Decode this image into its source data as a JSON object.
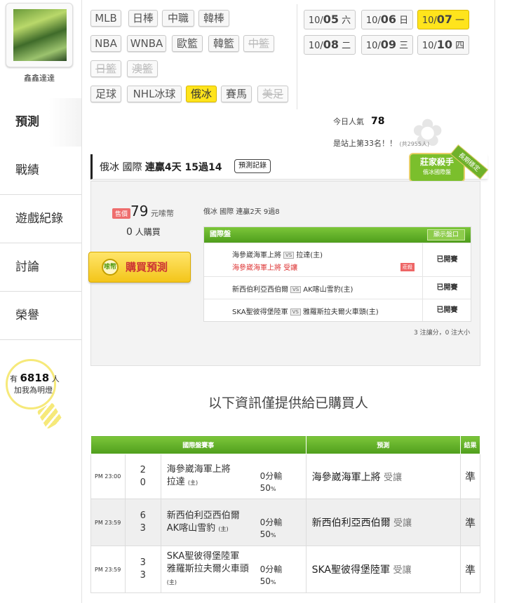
{
  "user": {
    "name": "鑫鑫達達"
  },
  "sidebar": {
    "items": [
      {
        "label": "預測"
      },
      {
        "label": "戰績"
      },
      {
        "label": "遊戲紀錄"
      },
      {
        "label": "討論"
      },
      {
        "label": "榮譽"
      }
    ]
  },
  "fans": {
    "prefix": "有",
    "count": "6818",
    "unit": "人",
    "caption": "加我為明燈"
  },
  "sports": [
    {
      "label": "MLB"
    },
    {
      "label": "日棒"
    },
    {
      "label": "中職"
    },
    {
      "label": "韓棒"
    },
    {
      "label": "NBA"
    },
    {
      "label": "WNBA"
    },
    {
      "label": "歐籃"
    },
    {
      "label": "韓籃"
    },
    {
      "label": "中籃"
    },
    {
      "label": "日籃"
    },
    {
      "label": "澳籃"
    },
    {
      "label": "足球"
    },
    {
      "label": "NHL冰球"
    },
    {
      "label": "俄冰"
    },
    {
      "label": "賽馬"
    },
    {
      "label": "美足"
    }
  ],
  "dates": [
    {
      "month": "10/",
      "day": "05",
      "weekday": "六"
    },
    {
      "month": "10/",
      "day": "06",
      "weekday": "日"
    },
    {
      "month": "10/",
      "day": "07",
      "weekday": "一"
    },
    {
      "month": "10/",
      "day": "08",
      "weekday": "二"
    },
    {
      "month": "10/",
      "day": "09",
      "weekday": "三"
    },
    {
      "month": "10/",
      "day": "10",
      "weekday": "四"
    }
  ],
  "popularity": {
    "label": "今日人氣",
    "value": "78",
    "rank_text": "是站上第33名！！",
    "rank_note": "(共2955人)"
  },
  "prediction_header": {
    "prefix": "俄冰 國際",
    "streak": "連贏4天 15過14",
    "record_button": "預測記錄"
  },
  "badge": {
    "title": "莊家殺手",
    "subtitle": "俄冰國際盤",
    "ribbon": "長期穩定"
  },
  "purchase": {
    "price_tag": "售價",
    "price": "79",
    "price_unit": "元嗦幣",
    "buyers_count": "0",
    "buyers_unit": "人購買",
    "buy_button": "購買預測",
    "coin_label": "嗦幣"
  },
  "sub_record": "俄冰 國際 連贏2天 9過8",
  "inner_table": {
    "title": "國際盤",
    "show_button": "顯示盤口",
    "rows": [
      {
        "home": "海參崴海軍上將",
        "away": "拉達(主)",
        "pick": "海參崴海軍上將 受讓",
        "pick_tag": "莊殺",
        "status": "已開賽"
      },
      {
        "home": "新西伯利亞西伯爾",
        "away": "AK喀山雪豹(主)",
        "status": "已開賽"
      },
      {
        "home": "SKA聖彼得堡陸軍",
        "away": "雅羅斯拉夫爾火車頭(主)",
        "status": "已開賽"
      }
    ],
    "vs": "VS",
    "note": "3 注讓分，0 注大小"
  },
  "info_title": "以下資訊僅提供給已購買人",
  "results": {
    "headers": [
      "國際盤賽事",
      "預測",
      "結果"
    ],
    "rows": [
      {
        "time": "PM 23:00",
        "score1": "2",
        "score2": "0",
        "team1": "海參崴海軍上將",
        "team2": "拉達",
        "team2_tag": "(主)",
        "handicap": "0分輸",
        "handicap_pct": "50",
        "handicap_pct_unit": "%",
        "pick": "海參崴海軍上將",
        "pick_type": "受讓",
        "result": "準"
      },
      {
        "time": "PM 23:59",
        "score1": "6",
        "score2": "3",
        "team1": "新西伯利亞西伯爾",
        "team2": "AK喀山雪豹",
        "team2_tag": "(主)",
        "handicap": "0分輸",
        "handicap_pct": "50",
        "handicap_pct_unit": "%",
        "pick": "新西伯利亞西伯爾",
        "pick_type": "受讓",
        "result": "準"
      },
      {
        "time": "PM 23:59",
        "score1": "3",
        "score2": "3",
        "team1": "SKA聖彼得堡陸軍",
        "team2": "雅羅斯拉夫爾火車頭",
        "team2_tag": "(主)",
        "handicap": "0分輸",
        "handicap_pct": "50",
        "handicap_pct_unit": "%",
        "pick": "SKA聖彼得堡陸軍",
        "pick_type": "受讓",
        "result": "準"
      }
    ]
  },
  "colors": {
    "accent_green": "#5aa823",
    "active_yellow": "#ffe41c",
    "pick_red": "#dd3333",
    "score_blue": "#1e5aa8"
  }
}
